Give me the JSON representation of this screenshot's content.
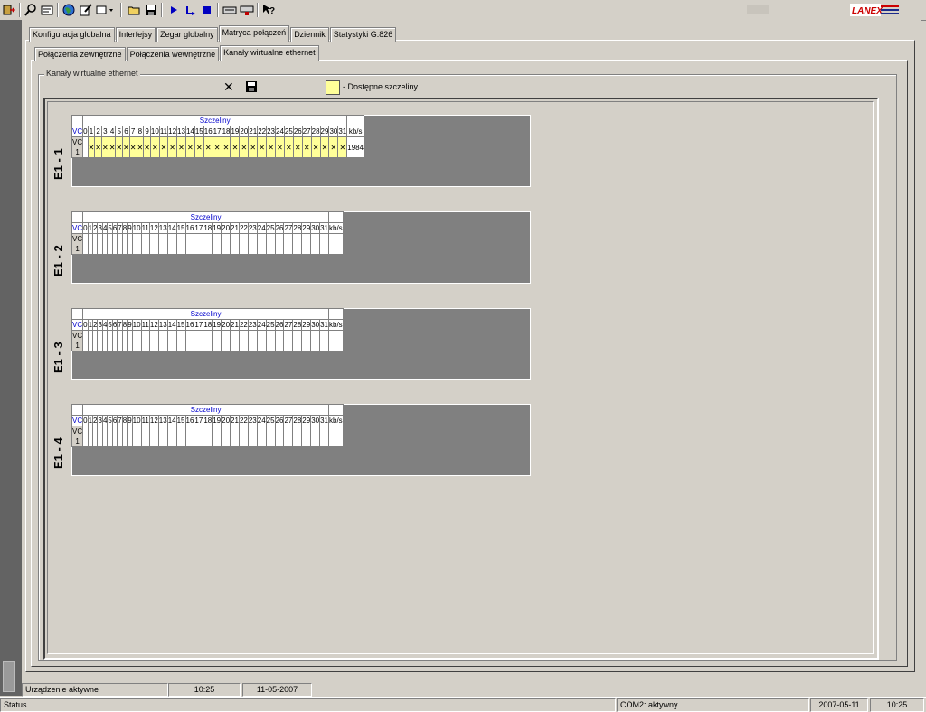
{
  "logo_text": "LANEX",
  "main_tabs": [
    {
      "label": "Konfiguracja globalna",
      "active": false
    },
    {
      "label": "Interfejsy",
      "active": false
    },
    {
      "label": "Zegar globalny",
      "active": false
    },
    {
      "label": "Matryca połączeń",
      "active": true
    },
    {
      "label": "Dziennik",
      "active": false
    },
    {
      "label": "Statystyki G.826",
      "active": false
    }
  ],
  "sub_tabs": [
    {
      "label": "Połączenia zewnętrzne",
      "active": false
    },
    {
      "label": "Połączenia wewnętrzne",
      "active": false
    },
    {
      "label": "Kanały wirtualne ethernet",
      "active": true
    }
  ],
  "group_title": "Kanały wirtualne ethernet",
  "legend": {
    "text": "- Dostępne szczeliny",
    "color": "#ffff99"
  },
  "grid_header": {
    "title": "Szczeliny",
    "vc": "VC",
    "kbs": "kb/s"
  },
  "slots": [
    "0",
    "1",
    "2",
    "3",
    "4",
    "5",
    "6",
    "7",
    "8",
    "9",
    "10",
    "11",
    "12",
    "13",
    "14",
    "15",
    "16",
    "17",
    "18",
    "19",
    "20",
    "21",
    "22",
    "23",
    "24",
    "25",
    "26",
    "27",
    "28",
    "29",
    "30",
    "31"
  ],
  "e1_blocks": [
    {
      "label": "E1 - 1",
      "vc_label": "VC 1",
      "kbs": "1984",
      "marked_slots": [
        1,
        2,
        3,
        4,
        5,
        6,
        7,
        8,
        9,
        10,
        11,
        12,
        13,
        14,
        15,
        16,
        17,
        18,
        19,
        20,
        21,
        22,
        23,
        24,
        25,
        26,
        27,
        28,
        29,
        30,
        31
      ]
    },
    {
      "label": "E1 - 2",
      "vc_label": "VC 1",
      "kbs": "",
      "marked_slots": []
    },
    {
      "label": "E1 - 3",
      "vc_label": "VC 1",
      "kbs": "",
      "marked_slots": []
    },
    {
      "label": "E1 - 4",
      "vc_label": "VC 1",
      "kbs": "",
      "marked_slots": []
    }
  ],
  "inner_status": {
    "device": "Urządzenie aktywne",
    "time": "10:25",
    "date": "11-05-2007"
  },
  "status_bar": {
    "status": "Status",
    "port": "COM2: aktywny",
    "date": "2007-05-11",
    "time": "10:25"
  },
  "colors": {
    "accent_blue": "#0000cc",
    "available_slot": "#ffff99"
  }
}
